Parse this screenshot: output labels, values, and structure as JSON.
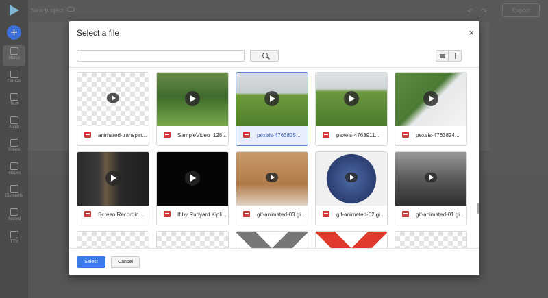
{
  "app": {
    "project_title": "New project",
    "export_label": "Export",
    "sidebar": [
      {
        "label": "Media",
        "icon": "upload-cloud-icon",
        "active": true
      },
      {
        "label": "Canvas",
        "icon": "canvas-icon"
      },
      {
        "label": "Text",
        "icon": "text-icon"
      },
      {
        "label": "Audio",
        "icon": "music-note-icon"
      },
      {
        "label": "Videos",
        "icon": "video-icon"
      },
      {
        "label": "Images",
        "icon": "image-icon"
      },
      {
        "label": "Elements",
        "icon": "shapes-icon"
      },
      {
        "label": "Record",
        "icon": "record-icon"
      },
      {
        "label": "TTS",
        "icon": "waveform-icon"
      }
    ]
  },
  "dialog": {
    "title": "Select a file",
    "close_symbol": "×",
    "search_value": "",
    "select_label": "Select",
    "cancel_label": "Cancel",
    "files": [
      {
        "name": "animated-transpar...",
        "type": "gif",
        "thumb": "checker",
        "selected": false
      },
      {
        "name": "SampleVideo_128...",
        "type": "video",
        "thumb": "rabbit",
        "selected": false
      },
      {
        "name": "pexels-4763825...",
        "type": "video",
        "thumb": "hills",
        "selected": true
      },
      {
        "name": "pexels-4763911...",
        "type": "video",
        "thumb": "hills2",
        "selected": false
      },
      {
        "name": "pexels-4763824...",
        "type": "video",
        "thumb": "mountain",
        "selected": false
      },
      {
        "name": "Screen Recording ...",
        "type": "video",
        "thumb": "screen",
        "selected": false
      },
      {
        "name": "If by Rudyard Kipli...",
        "type": "video",
        "thumb": "black",
        "selected": false
      },
      {
        "name": "gif-animated-03.gi...",
        "type": "gif",
        "thumb": "anime",
        "selected": false
      },
      {
        "name": "gif-animated-02.gi...",
        "type": "gif",
        "thumb": "movie",
        "selected": false
      },
      {
        "name": "gif-animated-01.gi...",
        "type": "gif",
        "thumb": "street",
        "selected": false
      },
      {
        "name": "",
        "type": "gif",
        "thumb": "checker",
        "selected": false
      },
      {
        "name": "",
        "type": "gif",
        "thumb": "checker",
        "selected": false
      },
      {
        "name": "",
        "type": "gif",
        "thumb": "grayx",
        "selected": false
      },
      {
        "name": "",
        "type": "gif",
        "thumb": "redx",
        "selected": false
      },
      {
        "name": "",
        "type": "gif",
        "thumb": "checker",
        "selected": false
      }
    ]
  },
  "colors": {
    "accent": "#3b7be8",
    "file_icon": "#d23a3a",
    "selected_text": "#3a62b7"
  }
}
